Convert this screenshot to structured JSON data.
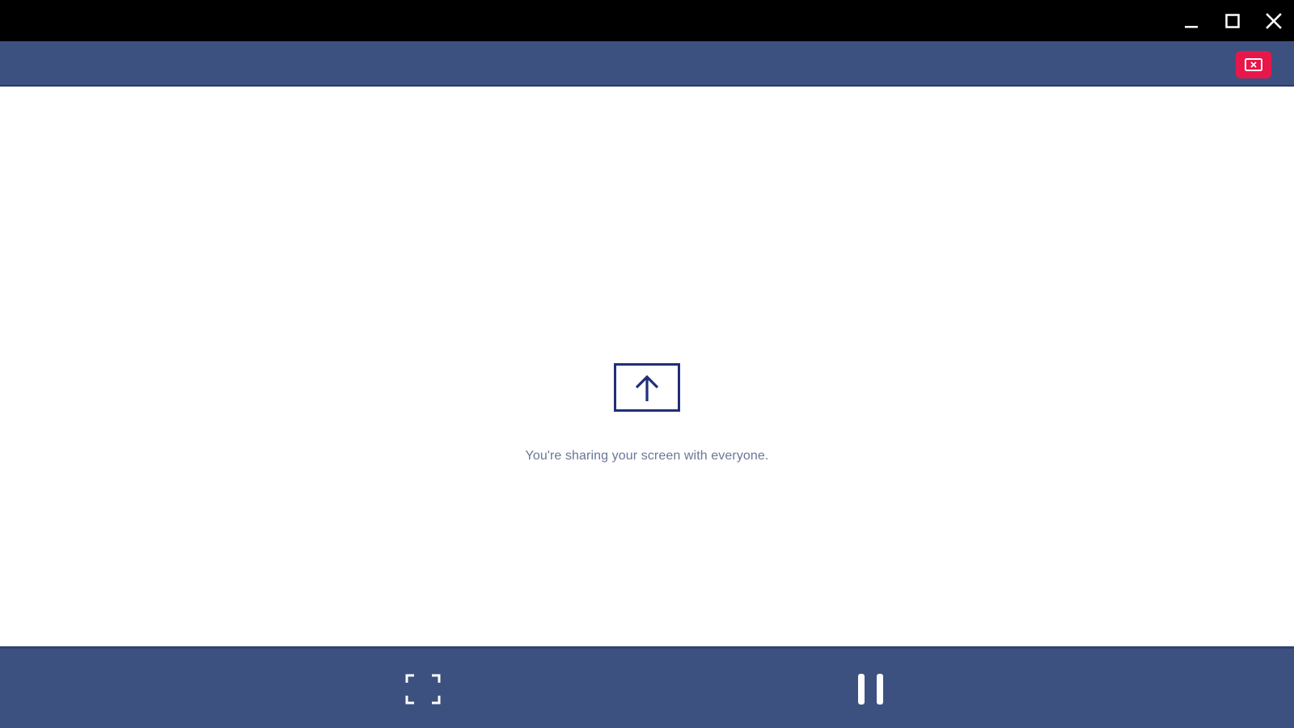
{
  "window_controls": {
    "minimize_icon": "minimize-icon",
    "maximize_icon": "maximize-icon",
    "close_icon": "close-icon"
  },
  "toolbar": {
    "stop_share_icon": "stop-screen-share-icon",
    "stop_share_color": "#e8174a"
  },
  "main": {
    "share_icon": "screen-share-icon",
    "message": "You're sharing your screen with everyone."
  },
  "controls": {
    "fullscreen_icon": "fullscreen-icon",
    "pause_icon": "pause-icon"
  },
  "colors": {
    "titlebar": "#000000",
    "bar": "#3d5180",
    "accent": "#1f2f78",
    "message_text": "#6b7796"
  }
}
